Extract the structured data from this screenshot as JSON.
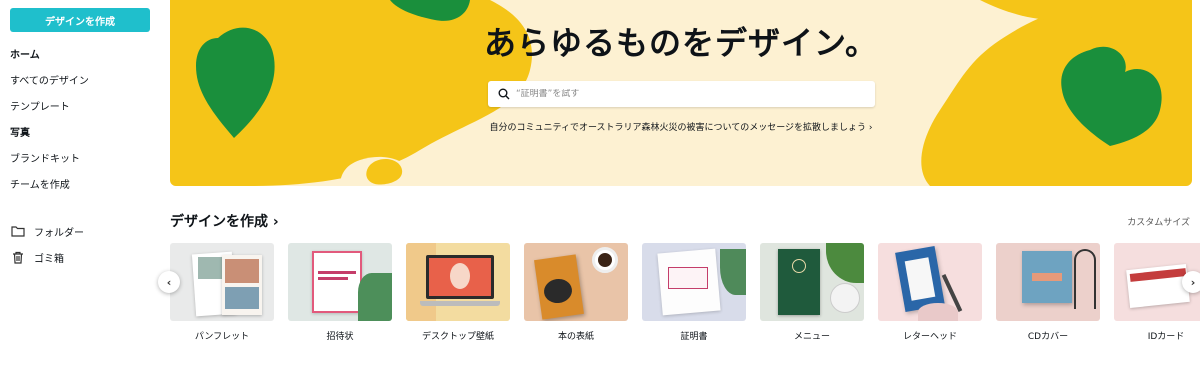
{
  "sidebar": {
    "create_button": "デザインを作成",
    "items": [
      {
        "label": "ホーム"
      },
      {
        "label": "すべてのデザイン"
      },
      {
        "label": "テンプレート"
      },
      {
        "label": "写真"
      },
      {
        "label": "ブランドキット"
      },
      {
        "label": "チームを作成"
      }
    ],
    "folder_label": "フォルダー",
    "trash_label": "ゴミ箱"
  },
  "banner": {
    "title": "あらゆるものをデザイン。",
    "search_placeholder": "“証明書”を試す",
    "promo_text": "自分のコミュニティでオーストラリア森林火災の被害についてのメッセージを拡散しましょう ›"
  },
  "section": {
    "title": "デザインを作成 ›",
    "custom_size": "カスタムサイズ"
  },
  "cards": [
    {
      "label": "パンフレット"
    },
    {
      "label": "招待状"
    },
    {
      "label": "デスクトップ壁紙"
    },
    {
      "label": "本の表紙"
    },
    {
      "label": "証明書"
    },
    {
      "label": "メニュー"
    },
    {
      "label": "レターヘッド"
    },
    {
      "label": "CDカバー"
    },
    {
      "label": "IDカード"
    }
  ],
  "colors": {
    "accent": "#1fbfcc",
    "banner_bg": "#fdf1d2",
    "banner_yellow": "#f5c518",
    "banner_green": "#1a8f3c"
  }
}
